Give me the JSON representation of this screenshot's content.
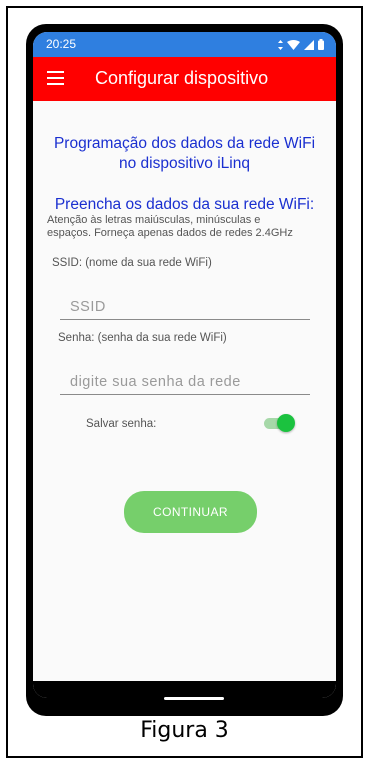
{
  "status": {
    "time": "20:25"
  },
  "appbar": {
    "title": "Configurar dispositivo"
  },
  "content": {
    "heading_line1": "Programação dos dados da rede WiFi",
    "heading_line2": "no dispositivo iLinq",
    "subheading": "Preencha os dados da sua rede WiFi:",
    "notice_line1": "Atenção às letras maiúsculas, minúsculas e",
    "notice_line2": "espaços. Forneça apenas dados de redes 2.4GHz"
  },
  "form": {
    "ssid_label": "SSID: (nome da sua rede WiFi)",
    "ssid_placeholder": "SSID",
    "password_label": "Senha: (senha da sua rede WiFi)",
    "password_placeholder": "digite sua senha da rede",
    "save_password_label": "Salvar senha:",
    "save_password_on": true,
    "continue_label": "CONTINUAR"
  },
  "caption": "Figura 3",
  "colors": {
    "statusbar": "#2f7fe0",
    "appbar": "#ff0000",
    "heading": "#1a2fd0",
    "toggle_on": "#1bc23f",
    "button": "#76cf6b"
  },
  "icons": [
    "menu-icon",
    "signal-icon",
    "wifi-icon",
    "cellular-icon",
    "battery-icon"
  ]
}
